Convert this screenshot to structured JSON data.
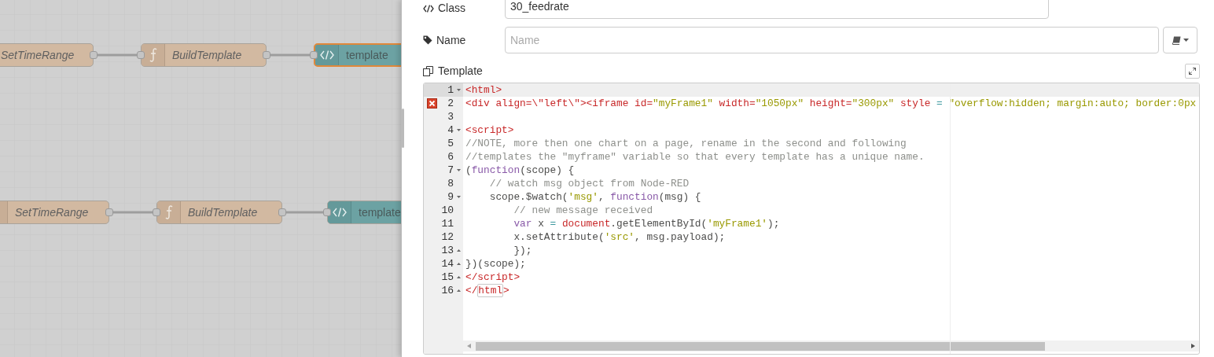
{
  "flow": {
    "rows": [
      {
        "nodes": [
          {
            "kind": "change",
            "label": "SetTimeRange",
            "selected": false
          },
          {
            "kind": "function",
            "label": "BuildTemplate",
            "selected": false
          },
          {
            "kind": "template",
            "label": "template",
            "selected": true
          }
        ]
      },
      {
        "nodes": [
          {
            "kind": "change",
            "label": "SetTimeRange",
            "selected": false
          },
          {
            "kind": "function",
            "label": "BuildTemplate",
            "selected": false
          },
          {
            "kind": "template",
            "label": "template",
            "selected": false
          }
        ]
      }
    ]
  },
  "properties": {
    "class": {
      "label": "Class",
      "value": "30_feedrate"
    },
    "name": {
      "label": "Name",
      "placeholder": "Name"
    },
    "template": {
      "label": "Template"
    }
  },
  "editor": {
    "lines": [
      {
        "number": "1",
        "fold_start": true,
        "fold_end": false,
        "active": true,
        "error": false,
        "tokens": [
          {
            "kind": "tag",
            "text": "<html>"
          }
        ]
      },
      {
        "number": "2",
        "fold_start": false,
        "fold_end": false,
        "active": false,
        "error": true,
        "tokens": [
          {
            "kind": "tag",
            "text": "<div align=\\\"left\\\"><iframe id="
          },
          {
            "kind": "string",
            "text": "\"myFrame1\""
          },
          {
            "kind": "tag",
            "text": " width="
          },
          {
            "kind": "string",
            "text": "\"1050px\""
          },
          {
            "kind": "tag",
            "text": " height="
          },
          {
            "kind": "string",
            "text": "\"300px\""
          },
          {
            "kind": "tag",
            "text": " style"
          },
          {
            "kind": "op",
            "text": " = "
          },
          {
            "kind": "string",
            "text": "\"overflow:hidden; margin:auto; border:0px"
          }
        ]
      },
      {
        "number": "3",
        "fold_start": false,
        "fold_end": false,
        "active": false,
        "error": false
      },
      {
        "number": "4",
        "fold_start": true,
        "fold_end": false,
        "active": false,
        "error": false,
        "tokens": [
          {
            "kind": "tag",
            "text": "<script>"
          }
        ]
      },
      {
        "number": "5",
        "fold_start": false,
        "fold_end": false,
        "active": false,
        "error": false,
        "tokens": [
          {
            "kind": "comment",
            "text": "//NOTE, more then one chart on a page, rename in the second and following"
          }
        ]
      },
      {
        "number": "6",
        "fold_start": false,
        "fold_end": false,
        "active": false,
        "error": false,
        "tokens": [
          {
            "kind": "comment",
            "text": "//templates the \"myframe\" variable so that every template has a unique name."
          }
        ]
      },
      {
        "number": "7",
        "fold_start": true,
        "fold_end": false,
        "active": false,
        "error": false,
        "tokens": [
          {
            "kind": "plain",
            "text": "("
          },
          {
            "kind": "keyword",
            "text": "function"
          },
          {
            "kind": "plain",
            "text": "(scope) {"
          }
        ]
      },
      {
        "number": "8",
        "fold_start": false,
        "fold_end": false,
        "active": false,
        "error": false,
        "tokens": [
          {
            "kind": "comment",
            "text": "    // watch msg object from Node-RED"
          }
        ]
      },
      {
        "number": "9",
        "fold_start": true,
        "fold_end": false,
        "active": false,
        "error": false,
        "tokens": [
          {
            "kind": "plain",
            "text": "    scope.$watch("
          },
          {
            "kind": "string",
            "text": "'msg'"
          },
          {
            "kind": "plain",
            "text": ", "
          },
          {
            "kind": "keyword",
            "text": "function"
          },
          {
            "kind": "plain",
            "text": "(msg) {"
          }
        ]
      },
      {
        "number": "10",
        "fold_start": false,
        "fold_end": false,
        "active": false,
        "error": false,
        "tokens": [
          {
            "kind": "comment",
            "text": "        // new message received"
          }
        ]
      },
      {
        "number": "11",
        "fold_start": false,
        "fold_end": false,
        "active": false,
        "error": false,
        "tokens": [
          {
            "kind": "keyword",
            "text": "        var"
          },
          {
            "kind": "plain",
            "text": " x "
          },
          {
            "kind": "op",
            "text": "= "
          },
          {
            "kind": "variable",
            "text": "document"
          },
          {
            "kind": "plain",
            "text": ".getElementById("
          },
          {
            "kind": "string",
            "text": "'myFrame1'"
          },
          {
            "kind": "plain",
            "text": ");"
          }
        ]
      },
      {
        "number": "12",
        "fold_start": false,
        "fold_end": false,
        "active": false,
        "error": false,
        "tokens": [
          {
            "kind": "plain",
            "text": "        x.setAttribute("
          },
          {
            "kind": "string",
            "text": "'src'"
          },
          {
            "kind": "plain",
            "text": ", msg.payload);"
          }
        ]
      },
      {
        "number": "13",
        "fold_start": false,
        "fold_end": true,
        "active": false,
        "error": false,
        "tokens": [
          {
            "kind": "plain",
            "text": "        });"
          }
        ]
      },
      {
        "number": "14",
        "fold_start": false,
        "fold_end": true,
        "active": false,
        "error": false,
        "tokens": [
          {
            "kind": "plain",
            "text": "})(scope);"
          }
        ]
      },
      {
        "number": "15",
        "fold_start": false,
        "fold_end": true,
        "active": false,
        "error": false,
        "tokens": [
          {
            "kind": "tag",
            "text": "</script>"
          }
        ]
      },
      {
        "number": "16",
        "fold_start": false,
        "fold_end": true,
        "active": false,
        "error": false,
        "tokens": [
          {
            "kind": "tag",
            "text": "</"
          },
          {
            "kind": "match",
            "text": "html"
          },
          {
            "kind": "tag",
            "text": ">"
          }
        ]
      }
    ]
  }
}
